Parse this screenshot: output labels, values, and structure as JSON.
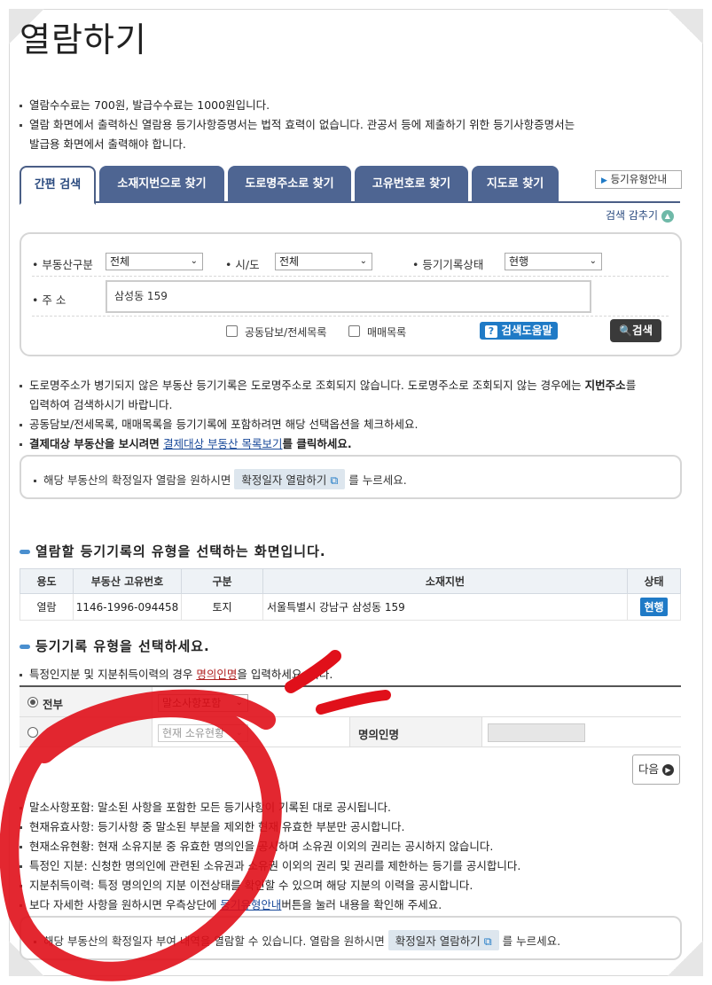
{
  "page_title": "열람하기",
  "top_notes": [
    "열람수수료는 700원, 발급수수료는 1000원입니다.",
    "열람 화면에서 출력하신 열람용 등기사항증명서는 법적 효력이 없습니다. 관공서 등에 제출하기 위한 등기사항증명서는",
    "발급용 화면에서 출력해야 합니다."
  ],
  "tabs": [
    "간편 검색",
    "소재지번으로 찾기",
    "도로명주소로 찾기",
    "고유번호로 찾기",
    "지도로 찾기"
  ],
  "guide_button": "등기유형안내",
  "hide_search": "검색 감추기",
  "search": {
    "property_type_label": "부동산구분",
    "property_type_value": "전체",
    "region_label": "시/도",
    "region_value": "전체",
    "record_status_label": "등기기록상태",
    "record_status_value": "현행",
    "address_label": "주 소",
    "address_value": "삼성동 159",
    "check_joint": "공동담보/전세목록",
    "check_sale": "매매목록",
    "help_button": "검색도움말",
    "search_button": "검색"
  },
  "mid_notes": {
    "note1a": "도로명주소가 병기되지 않은 부동산 등기기록은 도로명주소로 조회되지 않습니다. 도로명주소로 조회되지 않는 경우에는 ",
    "note1b": "지번주소",
    "note1c": "를",
    "note1d": "입력하여 검색하시기 바랍니다.",
    "note2": "공동담보/전세목록, 매매목록을 등기기록에 포함하려면 해당 선택옵션을 체크하세요.",
    "note3a": "결제대상 부동산을 보시려면 ",
    "note3b": "결제대상 부동산 목록보기",
    "note3c": "를 클릭하세요."
  },
  "info_box1": {
    "pre": "해당 부동산의 확정일자 열람을 원하시면",
    "pill": "확정일자 열람하기",
    "post": "를 누르세요."
  },
  "section1_title": "열람할 등기기록의 유형을 선택하는 화면입니다.",
  "record_table": {
    "headers": [
      "용도",
      "부동산 고유번호",
      "구분",
      "소재지번",
      "상태"
    ],
    "row": [
      "열람",
      "1146-1996-094458",
      "토지",
      "서울특별시 강남구 삼성동 159",
      "현행"
    ]
  },
  "section2_title": "등기기록 유형을 선택하세요.",
  "type_note": {
    "pre": "특정인지분 및 지분취득이력의 경우 ",
    "link": "명의인명",
    "post": "을 입력하세요. 니다."
  },
  "options": {
    "all_label": "전부",
    "all_select": "말소사항포함",
    "part_select": "현재 소유현황",
    "owner_name_label": "명의인명"
  },
  "next_button": "다음",
  "bottom_notes": [
    "말소사항포함: 말소된 사항을 포함한 모든 등기사항이 기록된 대로 공시됩니다.",
    "현재유효사항: 등기사항 중 말소된 부분을 제외한 현재 유효한 부분만 공시합니다.",
    "현재소유현황: 현재 소유지분 중 유효한 명의인을 공시하며 소유권 이외의 권리는 공시하지 않습니다.",
    "특정인 지분: 신청한 명의인에 관련된 소유권과 소유권 이외의 권리 및 권리를 제한하는 등기를 공시합니다.",
    "지분취득이력: 특정 명의인의 지분 이전상태를 확인할 수 있으며 해당 지분의 이력을 공시합니다."
  ],
  "bottom_note_last": {
    "pre": "보다 자세한 사항을 원하시면 우측상단에 ",
    "link": "등기유형안내",
    "post": "버튼을 눌러 내용을 확인해 주세요."
  },
  "info_box2": {
    "pre": "해당 부동산의 확정일자 부여 내역을 열람할 수 있습니다. 열람을 원하시면",
    "pill": "확정일자 열람하기",
    "post": "를 누르세요."
  },
  "colors": {
    "tab": "#4e6592",
    "accent_blue": "#1f7ac6",
    "annotation_red": "#e0101a"
  }
}
